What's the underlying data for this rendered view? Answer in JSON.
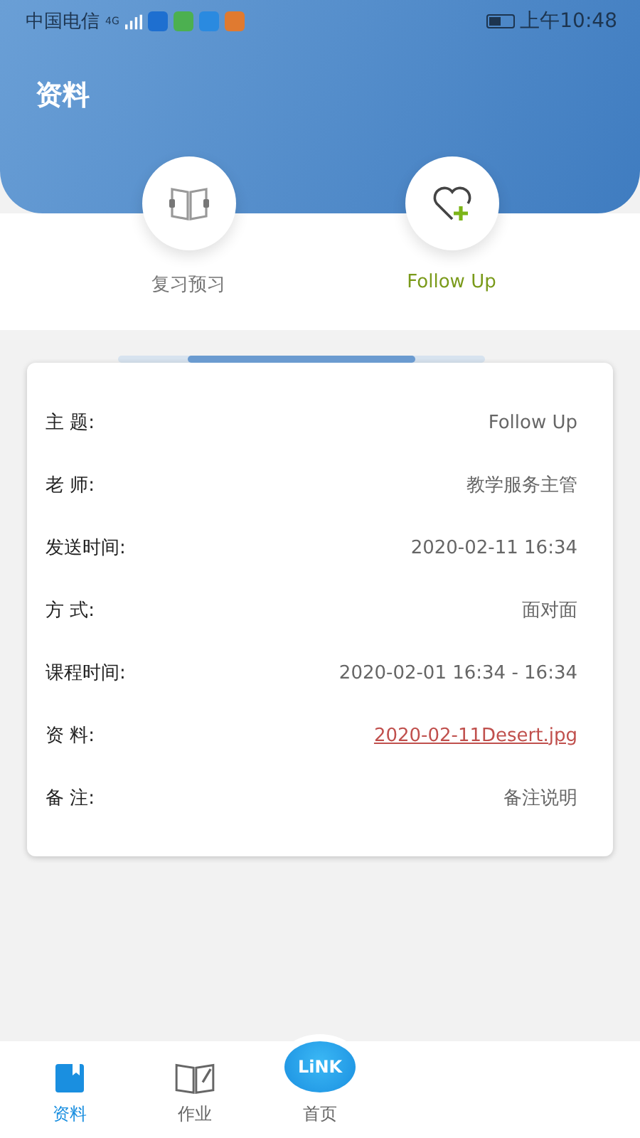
{
  "status_bar": {
    "carrier": "中国电信",
    "network": "4G",
    "time": "上午10:48"
  },
  "header": {
    "title": "资料"
  },
  "categories": [
    {
      "label": "复习预习",
      "kind": "book",
      "selected": false
    },
    {
      "label": "Follow Up",
      "kind": "heart",
      "selected": true
    }
  ],
  "details": [
    {
      "label": "主 题:",
      "value": "Follow Up",
      "kind": "text"
    },
    {
      "label": "老 师:",
      "value": "教学服务主管",
      "kind": "text"
    },
    {
      "label": "发送时间:",
      "value": "2020-02-11 16:34",
      "kind": "text"
    },
    {
      "label": "方 式:",
      "value": "面对面",
      "kind": "text"
    },
    {
      "label": "课程时间:",
      "value": "2020-02-01 16:34 - 16:34",
      "kind": "text"
    },
    {
      "label": "资 料:",
      "value": "2020-02-11Desert.jpg",
      "kind": "link"
    },
    {
      "label": "备 注:",
      "value": "备注说明",
      "kind": "text"
    }
  ],
  "bottom_nav": [
    {
      "label": "资料",
      "kind": "bookmark",
      "selected": true
    },
    {
      "label": "作业",
      "kind": "book",
      "selected": false
    },
    {
      "label": "首页",
      "kind": "link",
      "badge": "LiNK",
      "selected": false
    }
  ]
}
